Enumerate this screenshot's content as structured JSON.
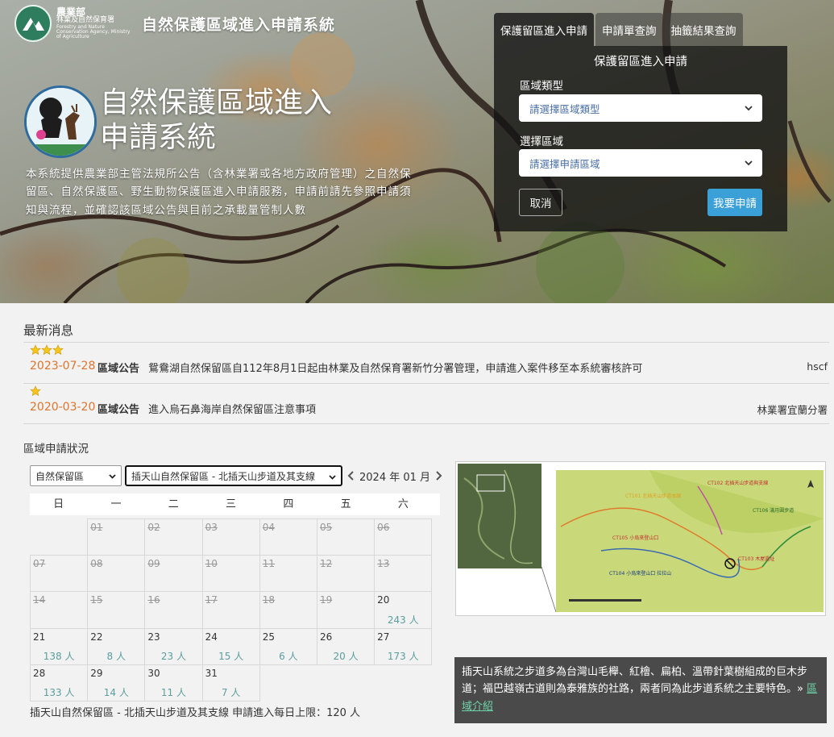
{
  "header": {
    "org_main": "農業部",
    "org_sub": "林業及自然保育署",
    "org_en": "Forestry and Nature Conservation Agency, Ministry of Agriculture",
    "site_title": "自然保護區域進入申請系統"
  },
  "hero": {
    "title_line1": "自然保護區域進入",
    "title_line2": "申請系統",
    "description": "本系統提供農業部主管法規所公告（含林業署或各地方政府管理）之自然保留區、自然保護區、野生動物保護區進入申請服務，申請前請先參照申請須知與流程，並確認該區域公告與目前之承載量管制人數"
  },
  "apply": {
    "tabs": [
      "保護留區進入申請",
      "申請單查詢",
      "抽籤結果查詢"
    ],
    "panel_title": "保護留區進入申請",
    "area_type_label": "區域類型",
    "area_type_placeholder": "請選擇區域類型",
    "area_label": "選擇區域",
    "area_placeholder": "請選擇申請區域",
    "cancel_label": "取消",
    "apply_label": "我要申請"
  },
  "news": {
    "heading": "最新消息",
    "items": [
      {
        "stars": 3,
        "date": "2023-07-28",
        "category": "區域公告",
        "text": "鴛鴦湖自然保留區自112年8月1日起由林業及自然保育署新竹分署管理，申請進入案件移至本系統審核許可",
        "source": "hscf"
      },
      {
        "stars": 1,
        "date": "2020-03-20",
        "category": "區域公告",
        "text": "進入烏石鼻海岸自然保留區注意事項",
        "source": "林業署宜蘭分署"
      }
    ]
  },
  "status": {
    "heading": "區域申請狀況",
    "type_selected": "自然保留區",
    "area_selected": "插天山自然保留區 - 北插天山步道及其支線",
    "month_label": "2024 年 01 月",
    "weekdays": [
      "日",
      "一",
      "二",
      "三",
      "四",
      "五",
      "六"
    ],
    "cells": [
      {
        "day": "",
        "count": "",
        "past": false
      },
      {
        "day": "01",
        "count": "",
        "past": true
      },
      {
        "day": "02",
        "count": "",
        "past": true
      },
      {
        "day": "03",
        "count": "",
        "past": true
      },
      {
        "day": "04",
        "count": "",
        "past": true
      },
      {
        "day": "05",
        "count": "",
        "past": true
      },
      {
        "day": "06",
        "count": "",
        "past": true
      },
      {
        "day": "07",
        "count": "",
        "past": true
      },
      {
        "day": "08",
        "count": "",
        "past": true
      },
      {
        "day": "09",
        "count": "",
        "past": true
      },
      {
        "day": "10",
        "count": "",
        "past": true
      },
      {
        "day": "11",
        "count": "",
        "past": true
      },
      {
        "day": "12",
        "count": "",
        "past": true
      },
      {
        "day": "13",
        "count": "",
        "past": true
      },
      {
        "day": "14",
        "count": "",
        "past": true
      },
      {
        "day": "15",
        "count": "",
        "past": true
      },
      {
        "day": "16",
        "count": "",
        "past": true
      },
      {
        "day": "17",
        "count": "",
        "past": true
      },
      {
        "day": "18",
        "count": "",
        "past": true
      },
      {
        "day": "19",
        "count": "",
        "past": true
      },
      {
        "day": "20",
        "count": "243 人",
        "past": false
      },
      {
        "day": "21",
        "count": "138 人",
        "past": false
      },
      {
        "day": "22",
        "count": "8 人",
        "past": false
      },
      {
        "day": "23",
        "count": "23 人",
        "past": false
      },
      {
        "day": "24",
        "count": "15 人",
        "past": false
      },
      {
        "day": "25",
        "count": "6 人",
        "past": false
      },
      {
        "day": "26",
        "count": "20 人",
        "past": false
      },
      {
        "day": "27",
        "count": "173 人",
        "past": false
      },
      {
        "day": "28",
        "count": "133 人",
        "past": false
      },
      {
        "day": "29",
        "count": "14 人",
        "past": false
      },
      {
        "day": "30",
        "count": "11 人",
        "past": false
      },
      {
        "day": "31",
        "count": "7 人",
        "past": false
      }
    ],
    "limit_prefix": "插天山自然保留區 - 北插天山步道及其支線 申請進入每日上限：",
    "limit_value": "120",
    "limit_unit": " 人"
  },
  "map": {
    "labels": [
      "CT102 北插天山步道與支線",
      "CT101 北插天山步道本線",
      "CT106 滿月圓步道",
      "CT105 小烏來登山口",
      "CT104 小烏來登山口 拉拉山",
      "CT103 木屋遺址"
    ]
  },
  "info": {
    "text": "插天山系統之步道多為台灣山毛櫸、紅檜、扁柏、溫帶針葉樹組成的巨木步道；福巴越嶺古道則為泰雅族的社路，兩者同為此步道系統之主要特色。",
    "link_prefix": "» ",
    "link_label": "區域介紹"
  },
  "colors": {
    "accent_blue": "#3b9fd8",
    "date_orange": "#e0742e",
    "count_teal": "#5b9e9e",
    "link_green": "#6fd3a8"
  }
}
